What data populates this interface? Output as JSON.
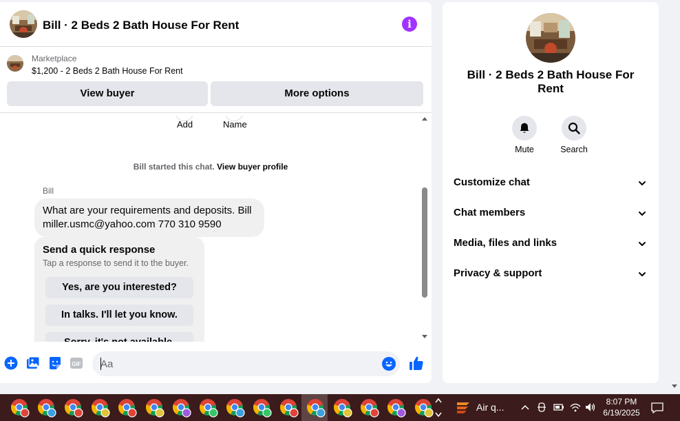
{
  "header": {
    "title": "Bill · 2 Beds 2 Bath House For Rent"
  },
  "marketplace": {
    "label": "Marketplace",
    "listing": "$1,200 - 2 Beds 2 Bath House For Rent",
    "view_buyer": "View buyer",
    "more_options": "More options"
  },
  "chat": {
    "add_label": "Add",
    "name_label": "Name",
    "system_text": "Bill started this chat.",
    "system_link": "View buyer profile",
    "sender": "Bill",
    "message": "What are your requirements and deposits.  Bill miller.usmc@yahoo.com 770 310 9590",
    "quick_title": "Send a quick response",
    "quick_subtitle": "Tap a response to send it to the buyer.",
    "quick_responses": [
      "Yes, are you interested?",
      "In talks. I'll let you know.",
      "Sorry, it's not available."
    ]
  },
  "composer": {
    "placeholder": "Aa",
    "gif_label": "GIF"
  },
  "info_panel": {
    "title": "Bill · 2 Beds 2 Bath House For Rent",
    "mute": "Mute",
    "search": "Search",
    "sections": [
      "Customize chat",
      "Chat members",
      "Media, files and links",
      "Privacy & support"
    ]
  },
  "taskbar": {
    "air_quality": "Air q...",
    "time": "8:07 PM",
    "date": "6/19/2025"
  },
  "colors": {
    "accent": "#0866ff",
    "info_purple": "#a033ff"
  }
}
